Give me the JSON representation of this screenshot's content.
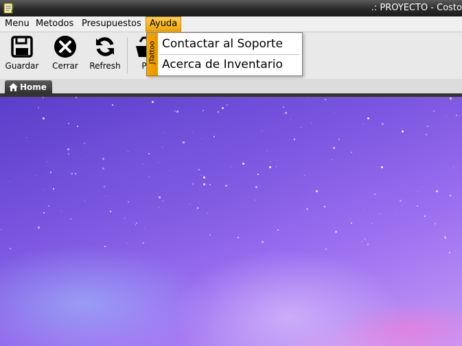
{
  "window": {
    "title": ".: PROYECTO - Costo"
  },
  "menubar": {
    "items": [
      {
        "label": "Menu"
      },
      {
        "label": "Metodos"
      },
      {
        "label": "Presupuestos"
      },
      {
        "label": "Ayuda"
      }
    ],
    "active": "Ayuda"
  },
  "toolbar": {
    "buttons": [
      {
        "label": "Guardar",
        "icon": "floppy-disk-icon"
      },
      {
        "label": "Cerrar",
        "icon": "close-circle-icon"
      },
      {
        "label": "Refresh",
        "icon": "refresh-icon"
      },
      {
        "label": "P",
        "icon": "basket-icon"
      }
    ]
  },
  "tabs": [
    {
      "label": "Home",
      "icon": "home-icon"
    }
  ],
  "dropdown": {
    "side_label": "JTattoo",
    "items": [
      {
        "label": "Contactar al Soporte"
      },
      {
        "label": "Acerca de Inventario"
      }
    ]
  },
  "colors": {
    "menu_highlight": "#f0a400",
    "titlebar": "#2a2a2a",
    "background_primary": "#7a55e0"
  }
}
